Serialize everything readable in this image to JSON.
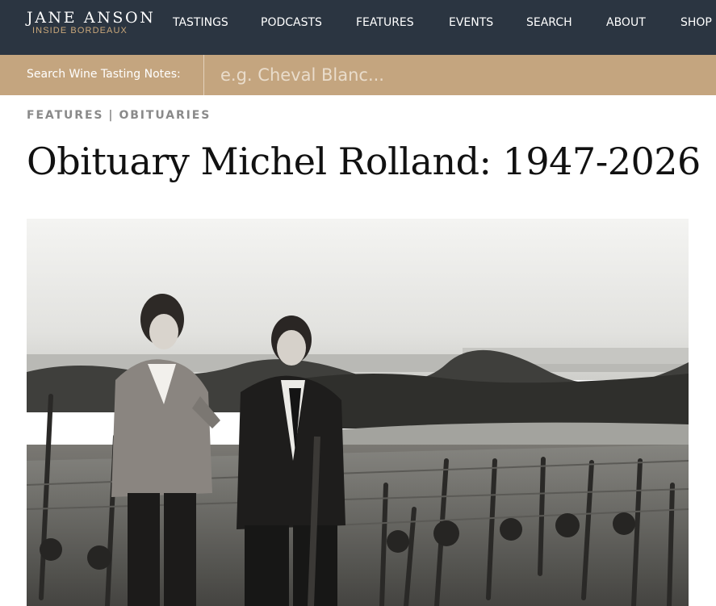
{
  "header": {
    "logo": {
      "name": "JANE ANSON",
      "tagline": "INSIDE BORDEAUX"
    },
    "nav": [
      {
        "label": "TASTINGS"
      },
      {
        "label": "PODCASTS"
      },
      {
        "label": "FEATURES"
      },
      {
        "label": "EVENTS"
      },
      {
        "label": "SEARCH"
      },
      {
        "label": "ABOUT"
      },
      {
        "label": "SHOP"
      }
    ]
  },
  "search": {
    "label": "Search Wine Tasting Notes:",
    "placeholder": "e.g. Cheval Blanc..."
  },
  "article": {
    "breadcrumb": [
      "FEATURES",
      "OBITUARIES"
    ],
    "breadcrumb_separator": "|",
    "title": "Obituary Michel Rolland: 1947-2026"
  },
  "colors": {
    "nav_background": "#2b3541",
    "search_background": "#c4a57f",
    "logo_accent": "#c9a77a"
  }
}
